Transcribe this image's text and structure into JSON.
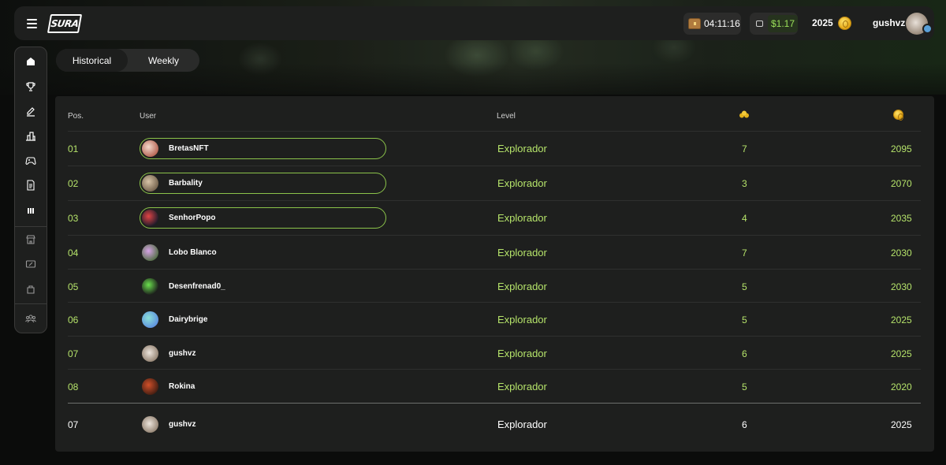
{
  "header": {
    "logo_text": "SURA",
    "timer": "04:11:16",
    "wallet_amount": "$1.17",
    "coins": "2025",
    "username": "gushvz"
  },
  "sidebar": {
    "items": [
      {
        "icon": "home-icon"
      },
      {
        "icon": "trophy-icon"
      },
      {
        "icon": "edit-icon"
      },
      {
        "icon": "buildings-icon"
      },
      {
        "icon": "gamepad-icon"
      },
      {
        "icon": "document-icon"
      },
      {
        "icon": "leaderboard-icon"
      },
      {
        "icon": "store-icon"
      },
      {
        "icon": "coupon-icon"
      },
      {
        "icon": "bag-icon"
      },
      {
        "icon": "community-icon"
      }
    ]
  },
  "tabs": [
    "Historical",
    "Weekly"
  ],
  "table": {
    "headers": {
      "pos": "Pos.",
      "user": "User",
      "level": "Level",
      "points_icon": "points-icon",
      "coins_icon": "coin-icon"
    },
    "rows": [
      {
        "pos": "01",
        "user": "BretasNFT",
        "level": "Explorador",
        "points": "7",
        "coins": "2095",
        "highlight": true
      },
      {
        "pos": "02",
        "user": "Barbality",
        "level": "Explorador",
        "points": "3",
        "coins": "2070",
        "highlight": true
      },
      {
        "pos": "03",
        "user": "SenhorPopo",
        "level": "Explorador",
        "points": "4",
        "coins": "2035",
        "highlight": true
      },
      {
        "pos": "04",
        "user": "Lobo Blanco",
        "level": "Explorador",
        "points": "7",
        "coins": "2030",
        "highlight": false
      },
      {
        "pos": "05",
        "user": "Desenfrenad0_",
        "level": "Explorador",
        "points": "5",
        "coins": "2030",
        "highlight": false
      },
      {
        "pos": "06",
        "user": "Dairybrige",
        "level": "Explorador",
        "points": "5",
        "coins": "2025",
        "highlight": false
      },
      {
        "pos": "07",
        "user": "gushvz",
        "level": "Explorador",
        "points": "6",
        "coins": "2025",
        "highlight": false
      },
      {
        "pos": "08",
        "user": "Rokina",
        "level": "Explorador",
        "points": "5",
        "coins": "2020",
        "highlight": false
      }
    ],
    "self_row": {
      "pos": "07",
      "user": "gushvz",
      "level": "Explorador",
      "points": "6",
      "coins": "2025"
    }
  },
  "colors": {
    "accent": "#b5e36a",
    "pill_border": "#8bc34a",
    "panel": "#1e1f1e"
  }
}
